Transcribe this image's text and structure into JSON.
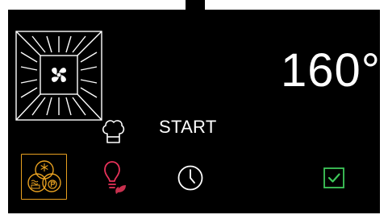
{
  "display": {
    "temperature": "160°",
    "start_label": "START"
  },
  "icons": {
    "oven": "oven-fan-icon",
    "chef": "chef-hat-icon",
    "eco": "eco-program-icon",
    "lamp": "lamp-eco-icon",
    "timer": "clock-icon",
    "confirm": "checkmark-icon"
  },
  "colors": {
    "background": "#000000",
    "text": "#ffffff",
    "accent_orange": "#e7a020",
    "lamp_red": "#e8325a",
    "leaf_red": "#c8304e",
    "confirm_green": "#3ec85a"
  }
}
